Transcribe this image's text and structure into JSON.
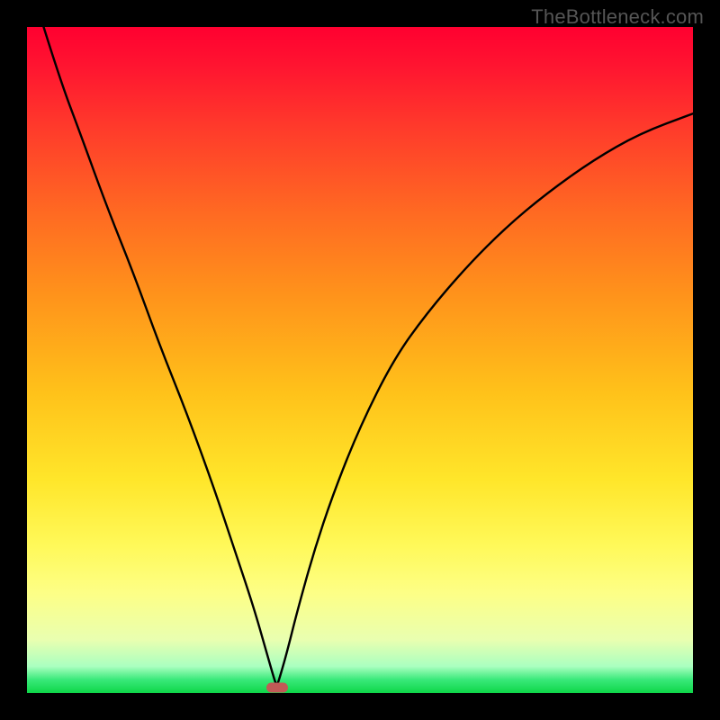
{
  "watermark": "TheBottleneck.com",
  "chart_data": {
    "type": "line",
    "title": "",
    "xlabel": "",
    "ylabel": "",
    "xlim": [
      0,
      100
    ],
    "ylim": [
      0,
      100
    ],
    "series": [
      {
        "name": "curve",
        "x": [
          2.5,
          5,
          8,
          12,
          16,
          20,
          24,
          28,
          31,
          34,
          36,
          37,
          37.5,
          38,
          39,
          40.5,
          43,
          46,
          50,
          55,
          60,
          66,
          72,
          78,
          85,
          92,
          100
        ],
        "values": [
          100,
          92,
          84,
          73,
          63,
          52,
          42,
          31,
          22,
          13,
          6,
          2.5,
          1,
          2.5,
          6,
          12,
          21,
          30,
          40,
          50,
          57,
          64,
          70,
          75,
          80,
          84,
          87
        ]
      }
    ],
    "minimum_marker": {
      "x": 37.5,
      "y": 0.8
    },
    "background_gradient": {
      "top": "#ff0030",
      "mid": "#ffe62a",
      "bottom": "#0ed648"
    },
    "frame_color": "#000000"
  }
}
